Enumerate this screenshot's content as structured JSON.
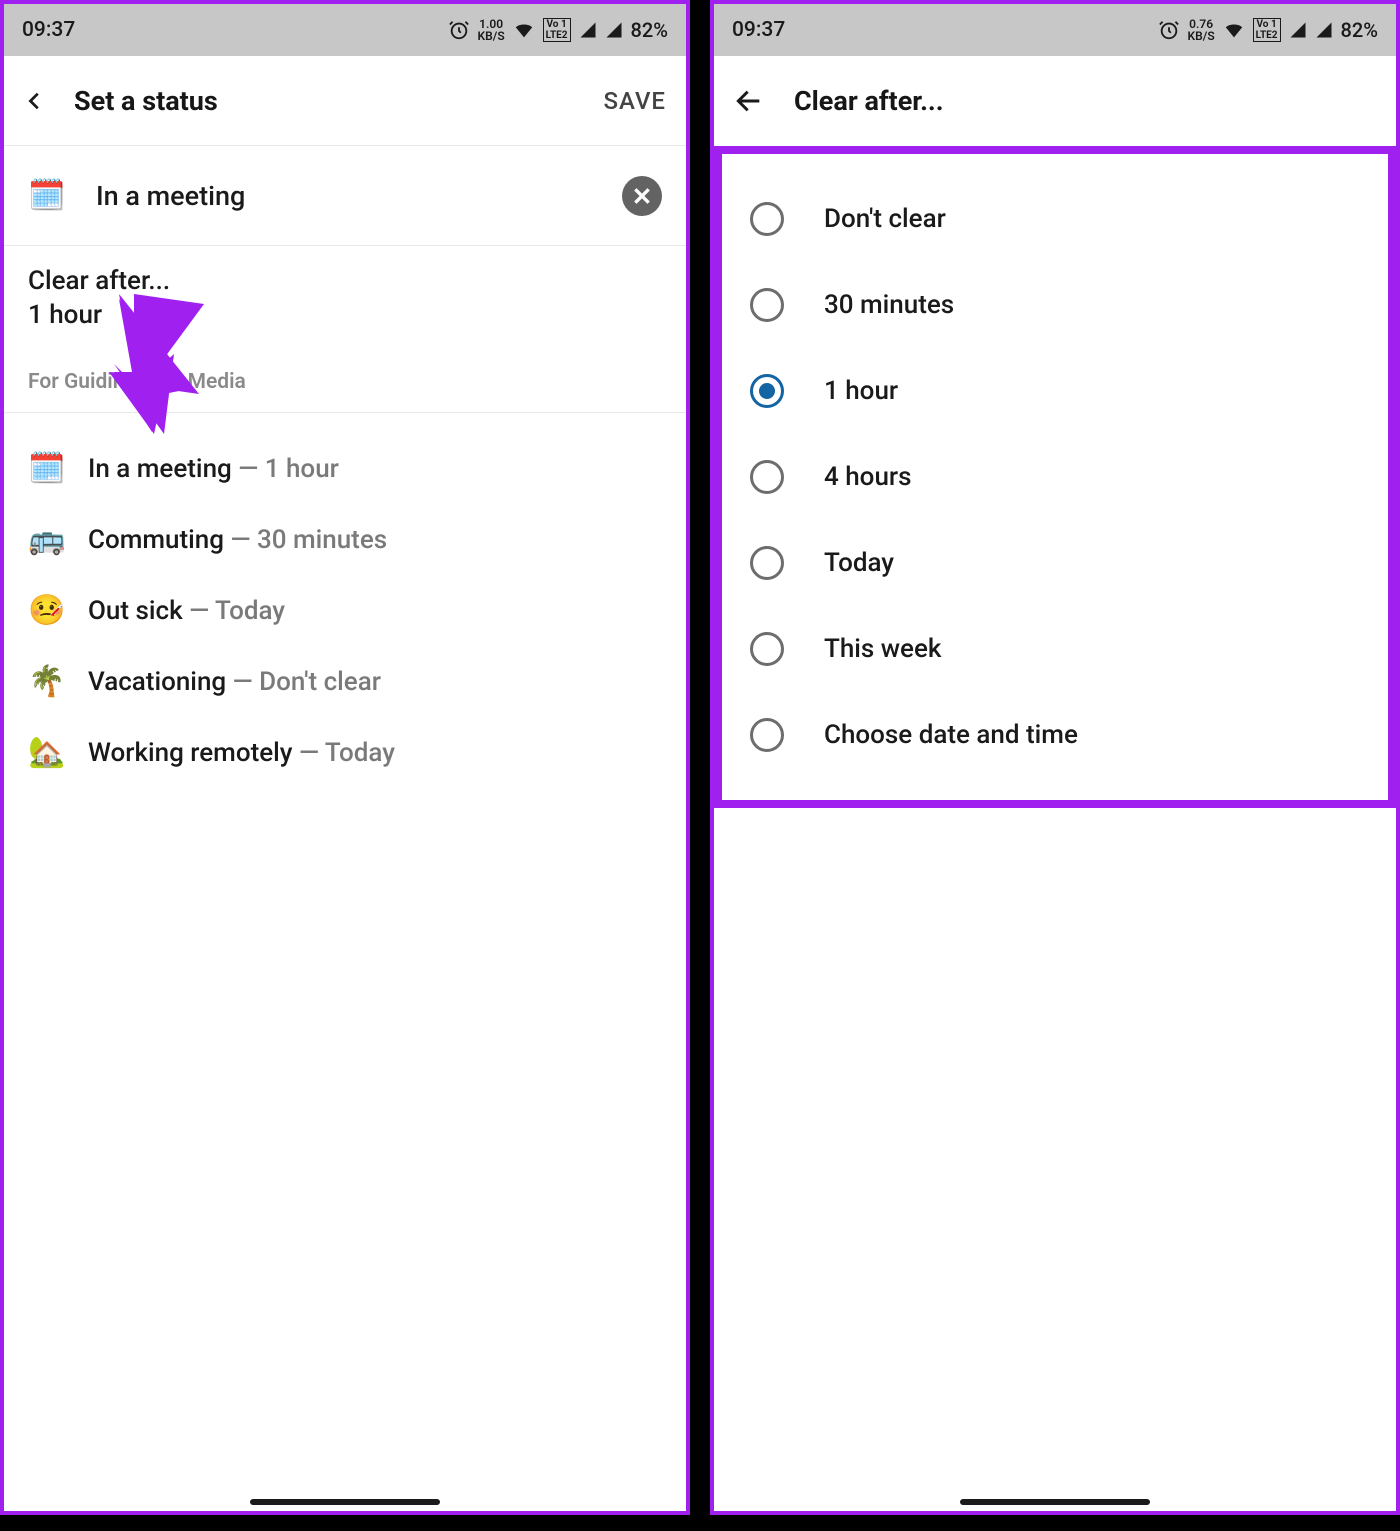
{
  "statusbar": {
    "time": "09:37",
    "kbs_left": "1.00",
    "kbs_left_unit": "KB/S",
    "kbs_right": "0.76",
    "kbs_right_unit": "KB/S",
    "lte_top": "Vo 1",
    "lte_bot": "LTE2",
    "battery": "82%"
  },
  "left": {
    "title": "Set a status",
    "save": "SAVE",
    "status_emoji": "🗓️",
    "status_text": "In a meeting",
    "clear_label": "Clear after...",
    "clear_value": "1 hour",
    "section_label": "For GuidingTech Media",
    "suggestions": [
      {
        "emoji": "🗓️",
        "text": "In a meeting",
        "dur": "1 hour"
      },
      {
        "emoji": "🚌",
        "text": "Commuting",
        "dur": "30 minutes"
      },
      {
        "emoji": "🤒",
        "text": "Out sick",
        "dur": "Today"
      },
      {
        "emoji": "🌴",
        "text": "Vacationing",
        "dur": "Don't clear"
      },
      {
        "emoji": "🏡",
        "text": "Working remotely",
        "dur": "Today"
      }
    ]
  },
  "right": {
    "title": "Clear after...",
    "options": [
      {
        "label": "Don't clear",
        "selected": false
      },
      {
        "label": "30 minutes",
        "selected": false
      },
      {
        "label": "1 hour",
        "selected": true
      },
      {
        "label": "4 hours",
        "selected": false
      },
      {
        "label": "Today",
        "selected": false
      },
      {
        "label": "This week",
        "selected": false
      },
      {
        "label": "Choose date and time",
        "selected": false
      }
    ]
  }
}
